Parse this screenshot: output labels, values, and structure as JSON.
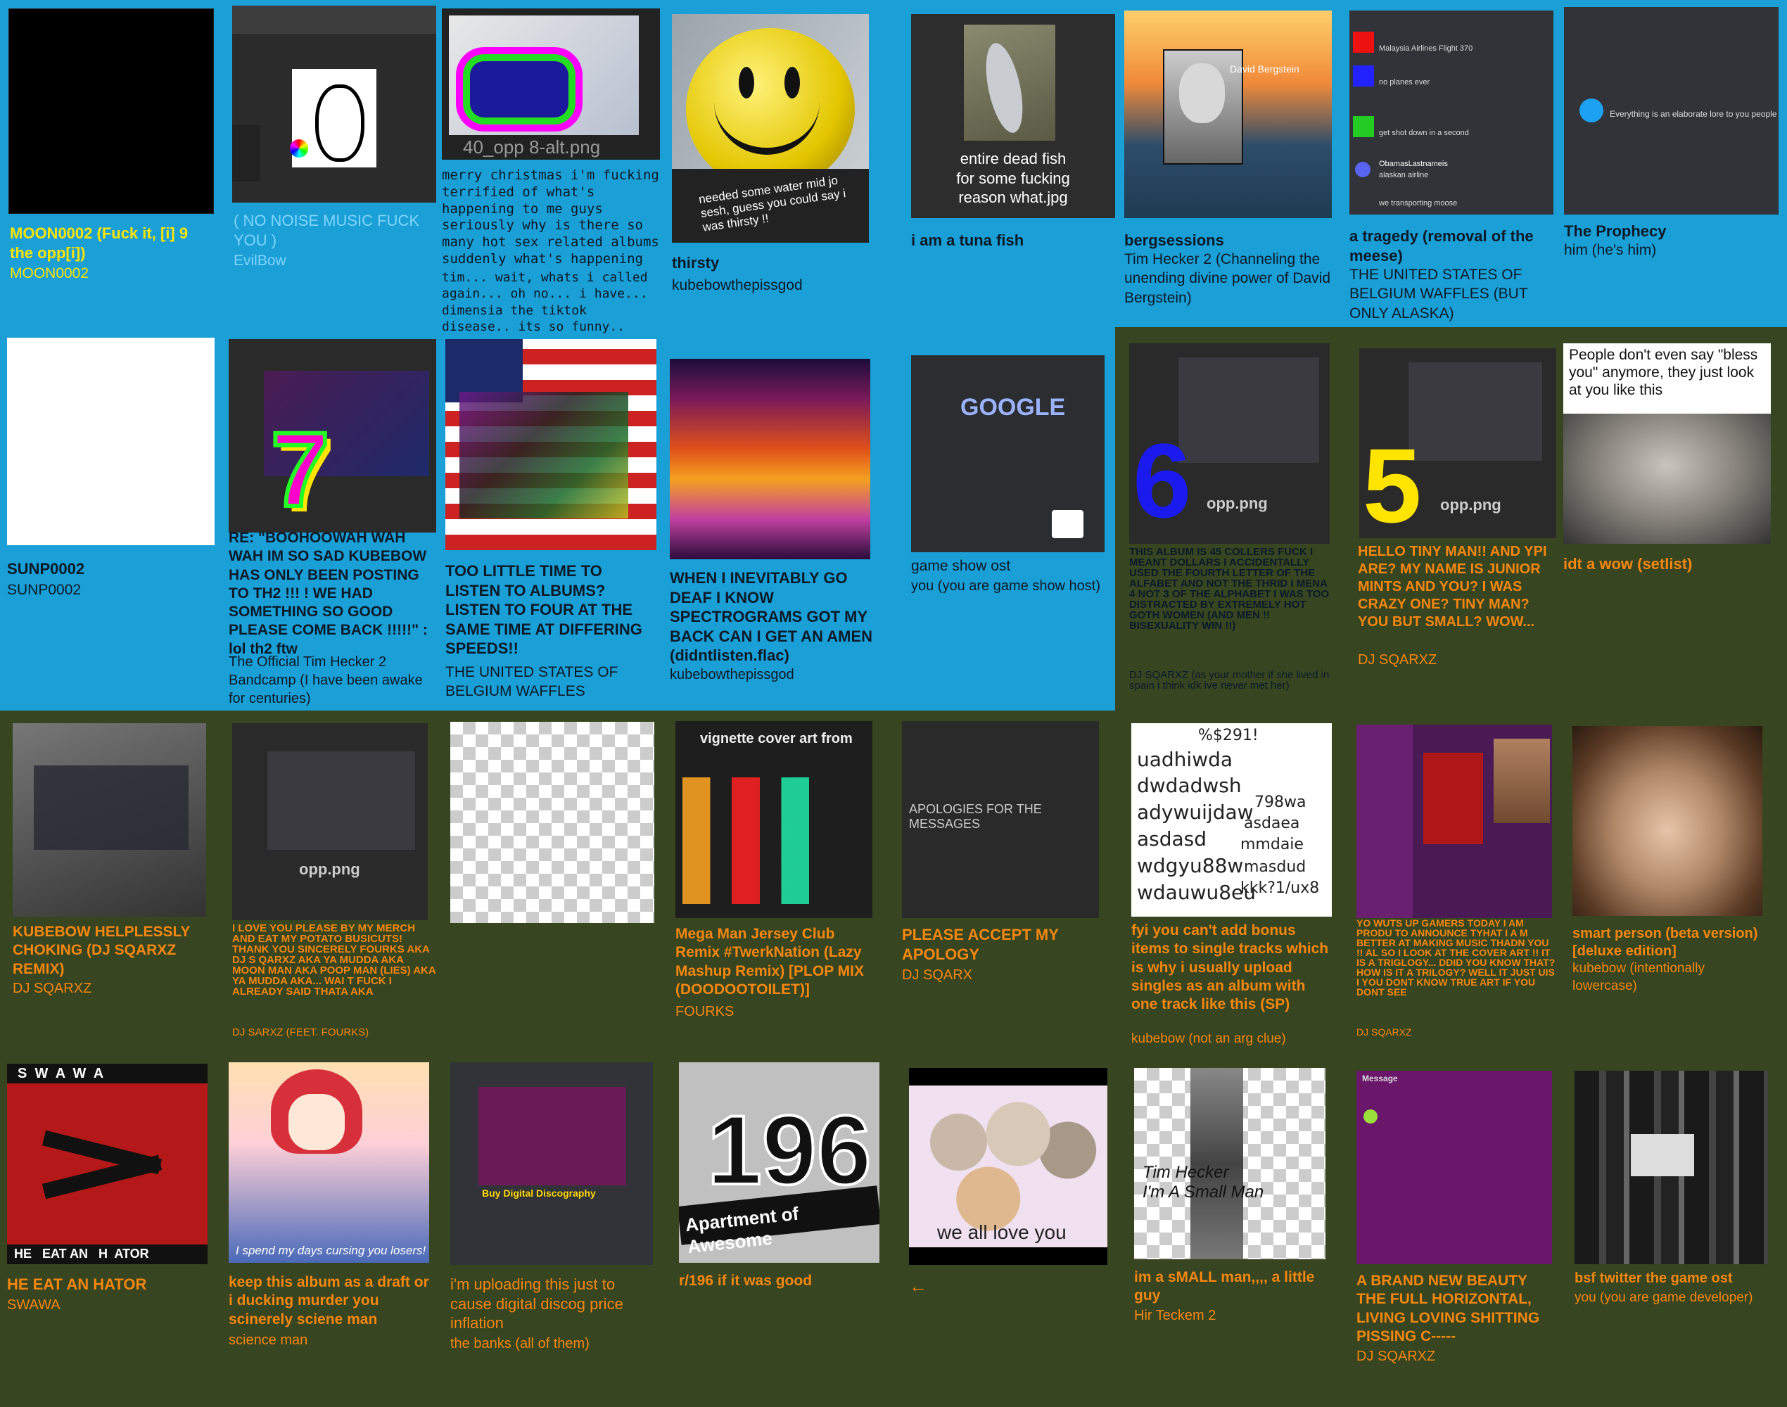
{
  "colors": {
    "blue_bg": "#1a9fd6",
    "olive_bg": "#374520",
    "orange_text": "#f5870f",
    "yellow_text": "#ffe400"
  },
  "row1": [
    {
      "title": "MOON0002 (Fuck it, [i] 9 the opp[i])",
      "artist": "MOON0002"
    },
    {
      "title": "( NO NOISE MUSIC FUCK YOU )",
      "artist": "EvilBow"
    },
    {
      "title": "merry christmas i'm fucking terrified of what's happening to me guys seriously why is there so many hot sex related albums suddenly what's happening",
      "artist": "tim... wait, whats i called again... oh no... i have... dimensia the tiktok disease.. its so funny..",
      "art_caption": "40_opp 8-alt.png"
    },
    {
      "title": "thirsty",
      "artist": "kubebowthepissgod",
      "art_caption": "needed some water mid jo sesh, guess you could say i was thirsty !!"
    },
    {
      "title": "i am a tuna fish",
      "artist": "",
      "art_caption": "entire dead fish for some fucking reason what.jpg"
    },
    {
      "title": "bergsessions",
      "artist": "Tim Hecker 2 (Channeling the unending divine power of David Bergstein)",
      "art_caption": "David Bergstein"
    },
    {
      "title": "a tragedy (removal of the meese)",
      "artist": "THE UNITED STATES OF BELGIUM WAFFLES (BUT ONLY ALASKA)",
      "art_lines": [
        "Malaysia Airlines Flight 370",
        "no planes ever",
        "get shot down in a second",
        "ObamasLastnameis",
        "alaskan airline",
        "we transporting moose"
      ]
    },
    {
      "title": "The Prophecy",
      "artist": "him (he's him)",
      "art_caption": "Everything is an elaborate lore to you people"
    }
  ],
  "row2": [
    {
      "title": "SUNP0002",
      "artist": "SUNP0002"
    },
    {
      "title": "RE: \"BOOHOOWAH WAH WAH IM SO SAD KUBEBOW HAS ONLY BEEN POSTING TO TH2 !!! ! WE HAD SOMETHING SO GOOD PLEASE COME BACK !!!!!\" : lol th2 ftw",
      "artist": "The Official Tim Hecker 2 Bandcamp (I have been awake for centuries)",
      "art_number": "7"
    },
    {
      "title": "TOO LITTLE TIME TO LISTEN TO ALBUMS? LISTEN TO FOUR AT THE SAME TIME AT DIFFERING SPEEDS!!",
      "artist": "THE UNITED STATES OF BELGIUM WAFFLES"
    },
    {
      "title": "WHEN I INEVITABLY GO DEAF I KNOW SPECTROGRAMS GOT MY BACK CAN I GET AN AMEN (didntlisten.flac)",
      "artist": "kubebowthepissgod"
    },
    {
      "title": "game show ost",
      "artist": "you (you are game show host)",
      "art_caption": "GOOGLE"
    },
    {
      "title": "THIS ALBUM IS 45 COLLERS FUCK I MEANT DOLLARS I ACCIDENTALLY USED THE FOURTH LETTER OF THE ALFABET AND NOT THE THRID I MENA 4 NOT 3 OF THE ALPHABET I WAS TOO DISTRACTED BY EXTREMELY HOT GOTH WOMEN (AND MEN !! BISEXUALITY WIN !!)",
      "artist": "DJ SQARXZ (as your mother if she lived in spain i think idk ive never met her)",
      "art_number": "6",
      "art_caption": "opp.png"
    },
    {
      "title": "HELLO TINY MAN!! AND YPI ARE? MY NAME IS JUNIOR MINTS AND YOU? I WAS CRAZY ONE? TINY MAN? YOU BUT SMALL? WOW...",
      "artist": "DJ SQARXZ",
      "art_number": "5",
      "art_caption": "opp.png"
    },
    {
      "title": "idt a wow (setlist)",
      "artist": "",
      "art_caption": "People don't even say \"bless you\" anymore, they just look at you like this"
    }
  ],
  "row3": [
    {
      "title": "KUBEBOW HELPLESSLY CHOKING (DJ SQARXZ REMIX)",
      "artist": "DJ SQARXZ"
    },
    {
      "title": "I LOVE YOU PLEASE BY MY MERCH AND EAT MY POTATO BUSICUTS! THANK YOU SINCERELY FOURKS AKA DJ S QARXZ AKA YA MUDDA AKA MOON MAN AKA POOP MAN (LIES) AKA YA MUDDA AKA... WAI T FUCK I ALREADY SAID THATA AKA",
      "artist": "DJ SARXZ (FEET. FOURKS)",
      "art_caption": "opp.png"
    },
    {
      "title": "",
      "artist": ""
    },
    {
      "title": "Mega Man Jersey Club Remix #TwerkNation (Lazy Mashup Remix) [PLOP MIX (DOODOOTOILET)]",
      "artist": "FOURKS",
      "art_caption": "vignette cover art from"
    },
    {
      "title": "PLEASE ACCEPT MY APOLOGY",
      "artist": "DJ SQARX",
      "art_caption": "APOLOGIES FOR THE MESSAGES"
    },
    {
      "title": "fyi you can't add bonus items to single tracks which is why i usually upload singles as an album with one track like this (SP)",
      "artist": "kubebow (not an arg clue)",
      "art_lines": [
        "%$291!",
        "uadhiwda",
        "dwdadwsh",
        "adywuijdaw",
        "asdasd",
        "wdgyu88w",
        "wdauwu8eu",
        "798wa",
        "asdaea",
        "mmdaie",
        "masdud",
        "kkk?1/ux8"
      ]
    },
    {
      "title": "YO WUTS UP GAMERS TODAY I AM PRODU TO ANNOUNCE TYHAT I A M BETTER AT MAKING MUSIC THADN YOU !! AL SO I LOOK AT THE COVER ART !! IT IS A TRIGLOGY... DDID YOU KNOW THAT? HOW IS IT A TRILOGY? WELL IT JUST UIS I YOU DONT KNOW TRUE ART IF YOU DONT SEE",
      "artist": "DJ SQARXZ"
    },
    {
      "title": "smart person (beta version) [deluxe edition]",
      "artist": "kubebow (intentionally lowercase)"
    }
  ],
  "row4": [
    {
      "title": "HE EAT AN HATOR",
      "artist": "SWAWA",
      "art_top": "S  W  A  W  A",
      "art_bottom": "HE   EAT AN   H  ATOR"
    },
    {
      "title": "keep this album as a draft or i ducking murder you scinerely sciene man",
      "artist": "science man",
      "art_caption": "I spend my days cursing you losers!"
    },
    {
      "title": "i'm uploading this just to cause digital discog price inflation",
      "artist": "the banks (all of them)",
      "art_caption": "Buy Digital Discography"
    },
    {
      "title": "r/196 if it was good",
      "artist": "",
      "art_caption": "Apartment of Awesome",
      "art_number": "196"
    },
    {
      "title": "←",
      "artist": "",
      "art_caption": "we all love you"
    },
    {
      "title": "im a sMALL man,,,, a little guy",
      "artist": "Hir Teckem 2",
      "art_caption": "Tim Hecker\nI'm A Small Man"
    },
    {
      "title": "A BRAND NEW BEAUTY THE FULL HORIZONTAL, LIVING LOVING SHITTING PISSING C-----",
      "artist": "DJ SQARXZ",
      "art_caption": "Message"
    },
    {
      "title": "bsf twitter the game ost",
      "artist": "you (you are game developer)"
    }
  ]
}
